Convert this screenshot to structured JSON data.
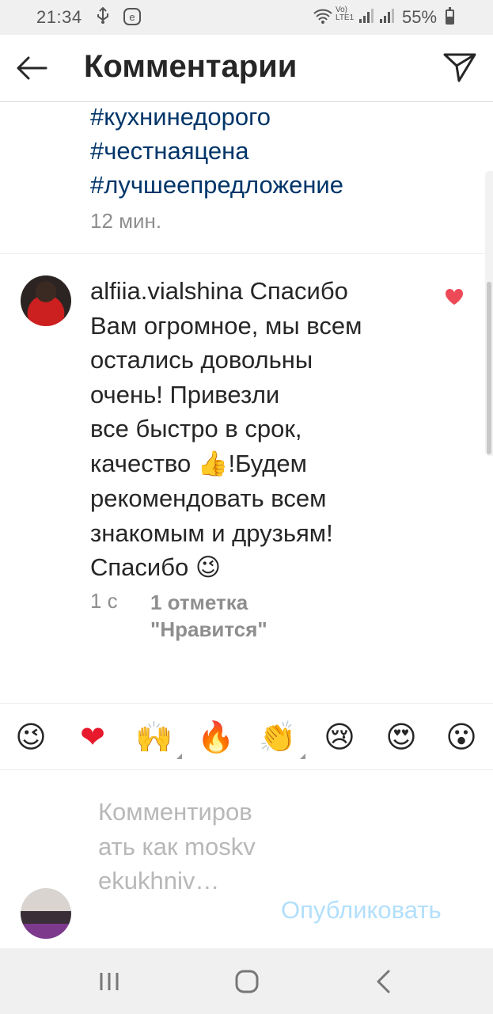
{
  "status_bar": {
    "time": "21:34",
    "icons": [
      "usb-icon",
      "notification-e-icon",
      "wifi-icon",
      "volte-lte-icon",
      "signal-icon",
      "signal-icon-2",
      "battery-icon"
    ],
    "volte_text": "Vo)\nLTE1",
    "battery_percent": "55%",
    "battery_level": 0.55
  },
  "header": {
    "title": "Комментарии",
    "back_icon": "arrow-left-icon",
    "send_icon": "paper-plane-icon"
  },
  "previous_comment": {
    "hashtags": [
      "#кухнинедорого",
      "#честнаяцена",
      "#лучшеепредложение"
    ],
    "age": "12 мин."
  },
  "comment": {
    "username": "alfiia.vialshina",
    "lines": [
      "Спасибо",
      "Вам огромное, мы всем",
      "остались довольны",
      "очень! Привезли",
      "все быстро в срок,",
      "качество",
      "!Будем",
      "рекомендовать всем",
      "знакомым и друзьям!",
      "Спасибо"
    ],
    "thumbs_emoji": "👍",
    "wink_emoji": "😉",
    "age": "1 с",
    "likes": "1 отметка \"Нравится\"",
    "liked": true
  },
  "reactions": [
    "😉",
    "❤",
    "🙌",
    "🔥",
    "👏",
    "😢",
    "😍",
    "😮"
  ],
  "composer": {
    "placeholder": "Комментировать как moskvekukhniv…",
    "publish_label": "Опубликовать"
  },
  "colors": {
    "hashtag": "#003569",
    "heart": "#ed4956",
    "publish_disabled": "#b2dffc",
    "secondary_text": "#8e8e8e"
  }
}
